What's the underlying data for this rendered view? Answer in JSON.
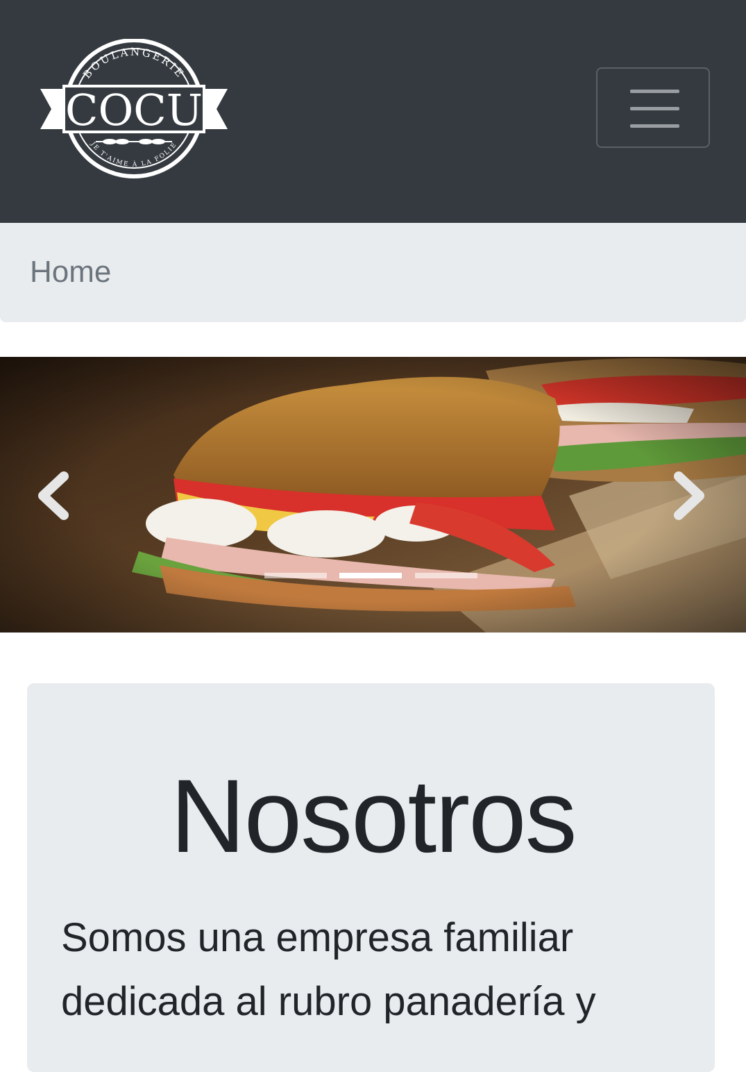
{
  "brand": {
    "logo_top_text": "BOULANGERIE",
    "logo_name": "COCU",
    "logo_bottom_text": "JE T'AIME À LA FOLIE",
    "colors": {
      "navbar": "#343a40",
      "logo": "#ffffff"
    }
  },
  "navbar": {
    "toggler_icon": "hamburger-icon"
  },
  "breadcrumb": {
    "items": [
      {
        "label": "Home"
      }
    ]
  },
  "carousel": {
    "slide_count": 3,
    "active_index": 1,
    "prev_icon": "chevron-left-icon",
    "next_icon": "chevron-right-icon",
    "image": "sandwich-photo"
  },
  "about": {
    "title": "Nosotros",
    "text": "Somos una empresa familiar dedicada al rubro panadería y"
  }
}
